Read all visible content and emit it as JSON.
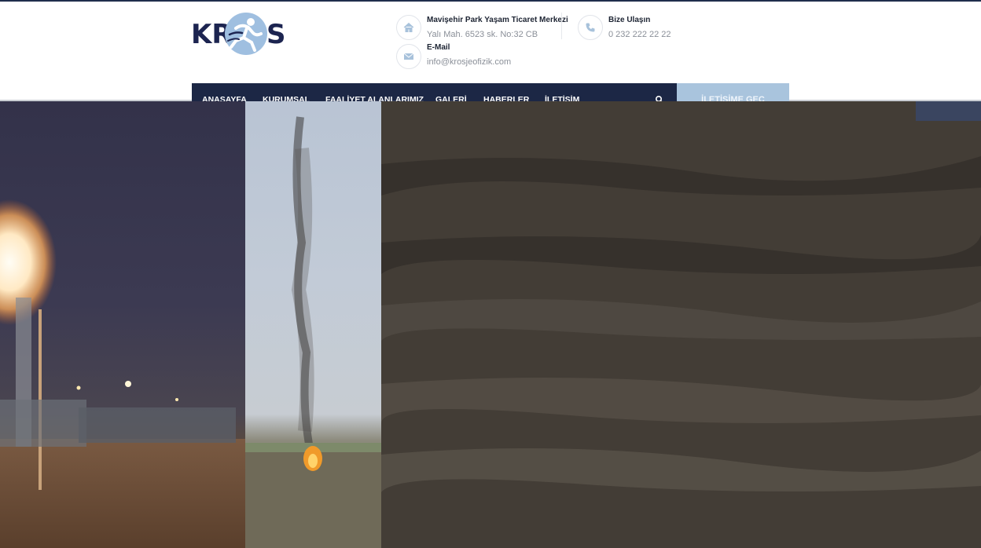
{
  "logo": {
    "left": "KR",
    "right": "S",
    "alt": "KROS"
  },
  "contact": {
    "address_title": "Mavişehir Park Yaşam Ticaret Merkezi",
    "address_text": "Yalı Mah. 6523 sk. No:32 CB",
    "email_title": "E-Mail",
    "email_text": "info@krosjeofizik.com",
    "phone_title": "Bize Ulaşın",
    "phone_text": "0 232 222 22 22"
  },
  "icons": {
    "address": "home-icon",
    "email": "envelope-icon",
    "phone": "phone-icon",
    "search": "search-icon"
  },
  "nav": {
    "items": [
      {
        "label": "ANASAYFA"
      },
      {
        "label": "KURUMSAL"
      },
      {
        "label": "FAALİYET ALANLARIMIZ"
      },
      {
        "label": "GALERİ"
      },
      {
        "label": "HABERLER"
      },
      {
        "label": "İLETİŞİM"
      }
    ]
  },
  "cta": {
    "label": "İLETİŞİME GEÇ"
  },
  "colors": {
    "navy": "#1c2745",
    "cta": "#a9c4dd",
    "logo_navy": "#1c2450",
    "logo_blue": "#9fbfe0"
  }
}
